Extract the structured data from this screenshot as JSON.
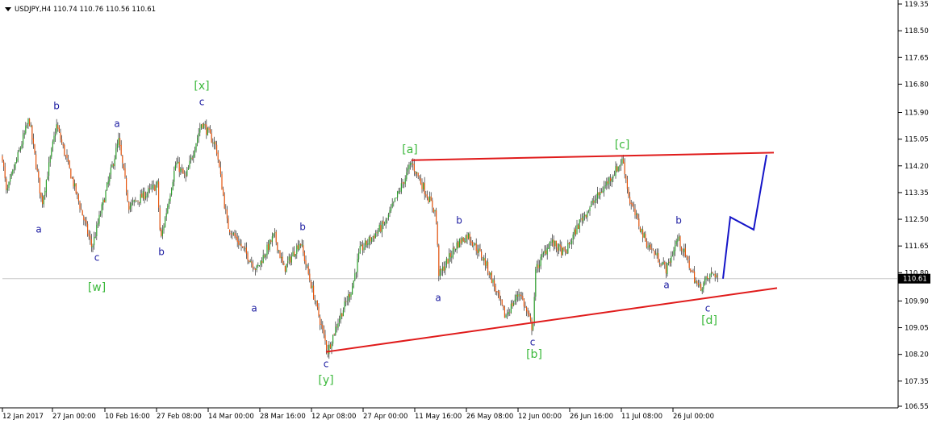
{
  "chart_data": {
    "type": "candlestick",
    "symbol": "USDJPY,H4",
    "ohlc": {
      "open": "110.74",
      "high": "110.76",
      "low": "110.56",
      "close": "110.61"
    },
    "current_price": 110.61,
    "current_price_label": "110.61",
    "ylim": [
      106.55,
      119.35
    ],
    "y_ticks": [
      "119.35",
      "118.50",
      "117.65",
      "116.80",
      "115.90",
      "115.05",
      "114.20",
      "113.35",
      "112.50",
      "111.65",
      "110.80",
      "109.90",
      "109.05",
      "108.20",
      "107.35",
      "106.55"
    ],
    "x_ticks": [
      "12 Jan 2017",
      "27 Jan 00:00",
      "10 Feb 16:00",
      "27 Feb 08:00",
      "14 Mar 00:00",
      "28 Mar 16:00",
      "12 Apr 08:00",
      "27 Apr 00:00",
      "11 May 16:00",
      "26 May 08:00",
      "12 Jun 00:00",
      "26 Jun 16:00",
      "11 Jul 08:00",
      "26 Jul 00:00"
    ],
    "colors": {
      "bull": "#2ca02c",
      "bear": "#e6550d",
      "wick": "#2a2a2a",
      "trendline": "#e01b1b",
      "projection": "#1515c8",
      "label_blue": "#1a1aa0",
      "label_green": "#3cb93c",
      "price_line": "#c8c8c8",
      "axis": "#000000"
    },
    "price_path": [
      {
        "x": "12 Jan 2017",
        "y": 115.2
      },
      {
        "y": 113.3
      },
      {
        "y": 115.7
      },
      {
        "y": 113.0
      },
      {
        "x": "27 Jan 00:00",
        "y": 115.5
      },
      {
        "y": 111.6
      },
      {
        "x": "10 Feb 16:00",
        "y": 115.0
      },
      {
        "y": 112.9
      },
      {
        "y": 113.6
      },
      {
        "y": 111.8
      },
      {
        "x": "27 Feb 08:00",
        "y": 114.3
      },
      {
        "y": 113.8
      },
      {
        "y": 115.6
      },
      {
        "y": 114.8
      },
      {
        "x": "14 Mar 00:00",
        "y": 112.3
      },
      {
        "y": 111.6
      },
      {
        "y": 110.9
      },
      {
        "x": "28 Mar 16:00",
        "y": 112.0
      },
      {
        "y": 110.9
      },
      {
        "y": 111.8
      },
      {
        "x": "12 Apr 08:00",
        "y": 108.3
      },
      {
        "y": 109.2
      },
      {
        "y": 110.3
      },
      {
        "y": 111.5
      },
      {
        "x": "27 Apr 00:00",
        "y": 112.4
      },
      {
        "y": 114.3
      },
      {
        "x": "11 May 16:00",
        "y": 112.7
      },
      {
        "y": 110.7
      },
      {
        "y": 111.7
      },
      {
        "y": 112.0
      },
      {
        "x": "26 May 08:00",
        "y": 111.2
      },
      {
        "y": 110.7
      },
      {
        "y": 109.4
      },
      {
        "y": 110.2
      },
      {
        "x": "12 Jun 00:00",
        "y": 109.0
      },
      {
        "y": 110.9
      },
      {
        "y": 111.8
      },
      {
        "y": 111.4
      },
      {
        "x": "26 Jun 16:00",
        "y": 112.5
      },
      {
        "y": 113.2
      },
      {
        "y": 114.4
      },
      {
        "x": "11 Jul 08:00",
        "y": 113.1
      },
      {
        "y": 111.8
      },
      {
        "y": 110.9
      },
      {
        "y": 111.9
      },
      {
        "x": "26 Jul 00:00",
        "y": 110.3
      },
      {
        "y": 110.8
      },
      {
        "y": 110.6
      }
    ],
    "trendlines": [
      {
        "name": "upper",
        "from": {
          "x": "11 May 16:00",
          "y": 114.38
        },
        "to": {
          "y": 114.62
        }
      },
      {
        "name": "lower",
        "from": {
          "x": "12 Apr 08:00",
          "y": 108.28
        },
        "to": {
          "y": 110.31
        }
      }
    ],
    "projection_path": [
      110.61,
      112.57,
      112.17,
      114.55
    ],
    "wave_labels": [
      {
        "text": "b",
        "color": "blue"
      },
      {
        "text": "a",
        "color": "blue"
      },
      {
        "text": "c",
        "color": "blue"
      },
      {
        "text": "[w]",
        "color": "green"
      },
      {
        "text": "a",
        "color": "blue"
      },
      {
        "text": "b",
        "color": "blue"
      },
      {
        "text": "[x]",
        "color": "green"
      },
      {
        "text": "c",
        "color": "blue"
      },
      {
        "text": "a",
        "color": "blue"
      },
      {
        "text": "b",
        "color": "blue"
      },
      {
        "text": "c",
        "color": "blue"
      },
      {
        "text": "[y]",
        "color": "green"
      },
      {
        "text": "[a]",
        "color": "green"
      },
      {
        "text": "a",
        "color": "blue"
      },
      {
        "text": "b",
        "color": "blue"
      },
      {
        "text": "c",
        "color": "blue"
      },
      {
        "text": "[b]",
        "color": "green"
      },
      {
        "text": "[c]",
        "color": "green"
      },
      {
        "text": "b",
        "color": "blue"
      },
      {
        "text": "a",
        "color": "blue"
      },
      {
        "text": "c",
        "color": "blue"
      },
      {
        "text": "[d]",
        "color": "green"
      }
    ]
  }
}
